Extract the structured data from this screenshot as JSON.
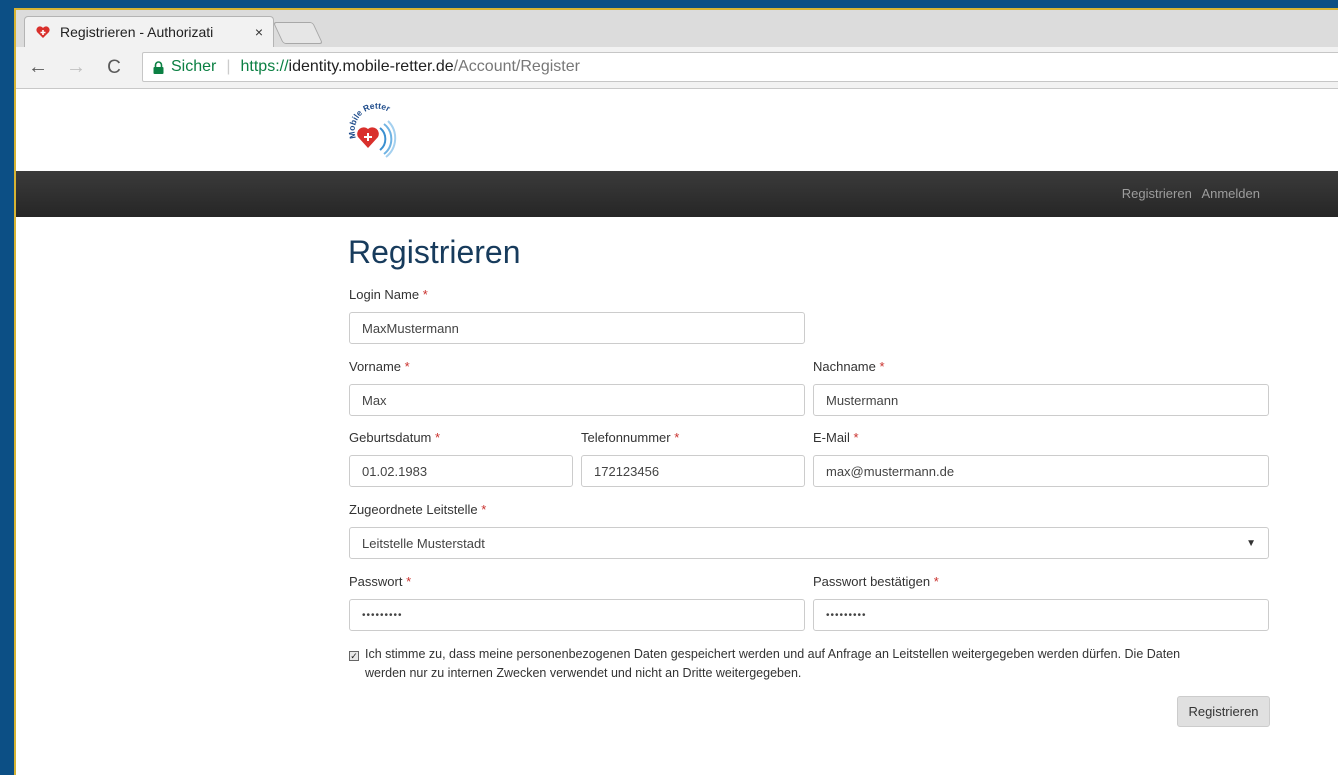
{
  "browser": {
    "tab_title": "Registrieren - Authorizati",
    "tab_close": "×",
    "back": "←",
    "forward": "→",
    "reload": "C",
    "secure_label": "Sicher",
    "url_scheme": "https://",
    "url_host": "identity.mobile-retter.de",
    "url_path": "/Account/Register"
  },
  "logo_text": "Mobile Retter",
  "nav": {
    "register": "Registrieren",
    "login": "Anmelden"
  },
  "page_title": "Registrieren",
  "required_marker": "*",
  "form": {
    "login_name": {
      "label": "Login Name",
      "value": "MaxMustermann"
    },
    "first_name": {
      "label": "Vorname",
      "value": "Max"
    },
    "last_name": {
      "label": "Nachname",
      "value": "Mustermann"
    },
    "birth_date": {
      "label": "Geburtsdatum",
      "value": "01.02.1983"
    },
    "phone": {
      "label": "Telefonnummer",
      "value": "172123456"
    },
    "email": {
      "label": "E-Mail",
      "value": "max@mustermann.de"
    },
    "dispatch": {
      "label": "Zugeordnete Leitstelle",
      "value": "Leitstelle Musterstadt"
    },
    "password": {
      "label": "Passwort",
      "value": "•••••••••"
    },
    "password_confirm": {
      "label": "Passwort bestätigen",
      "value": "•••••••••"
    },
    "consent_checked": true,
    "consent_line1": "Ich stimme zu, dass meine personenbezogenen Daten gespeichert werden und auf Anfrage an Leitstellen weitergegeben werden dürfen. Die Daten",
    "consent_line2": "werden nur zu internen Zwecken verwendet und nicht an Dritte weitergegeben.",
    "submit_label": "Registrieren"
  },
  "colors": {
    "title": "#173b5c",
    "navbar": "#262626",
    "required": "#c9302c",
    "secure": "#0b8043"
  }
}
